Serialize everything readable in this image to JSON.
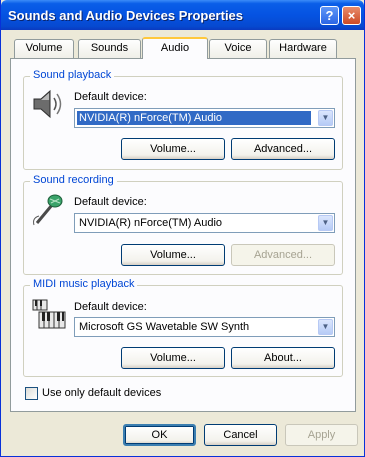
{
  "window": {
    "title": "Sounds and Audio Devices Properties"
  },
  "titlebar": {
    "help_glyph": "?",
    "close_glyph": "×"
  },
  "tabs": [
    {
      "label": "Volume"
    },
    {
      "label": "Sounds"
    },
    {
      "label": "Audio",
      "active": true
    },
    {
      "label": "Voice"
    },
    {
      "label": "Hardware"
    }
  ],
  "playback": {
    "group_label": "Sound playback",
    "default_label": "Default device:",
    "device": "NVIDIA(R) nForce(TM) Audio",
    "volume_button": "Volume...",
    "advanced_button": "Advanced..."
  },
  "recording": {
    "group_label": "Sound recording",
    "default_label": "Default device:",
    "device": "NVIDIA(R) nForce(TM) Audio",
    "volume_button": "Volume...",
    "advanced_button": "Advanced..."
  },
  "midi": {
    "group_label": "MIDI music playback",
    "default_label": "Default device:",
    "device": "Microsoft GS Wavetable SW Synth",
    "volume_button": "Volume...",
    "about_button": "About..."
  },
  "options": {
    "default_devices_label": "Use only default devices",
    "default_devices_checked": false
  },
  "footer": {
    "ok_label": "OK",
    "cancel_label": "Cancel",
    "apply_label": "Apply"
  },
  "icons": {
    "speaker": "speaker-icon",
    "microphone": "microphone-icon",
    "midi": "midi-keyboard-icon"
  },
  "colors": {
    "titlebar": "#0553e2",
    "group_label": "#0046d5",
    "selection": "#316ac5",
    "active_tab": "#ffc83c"
  }
}
